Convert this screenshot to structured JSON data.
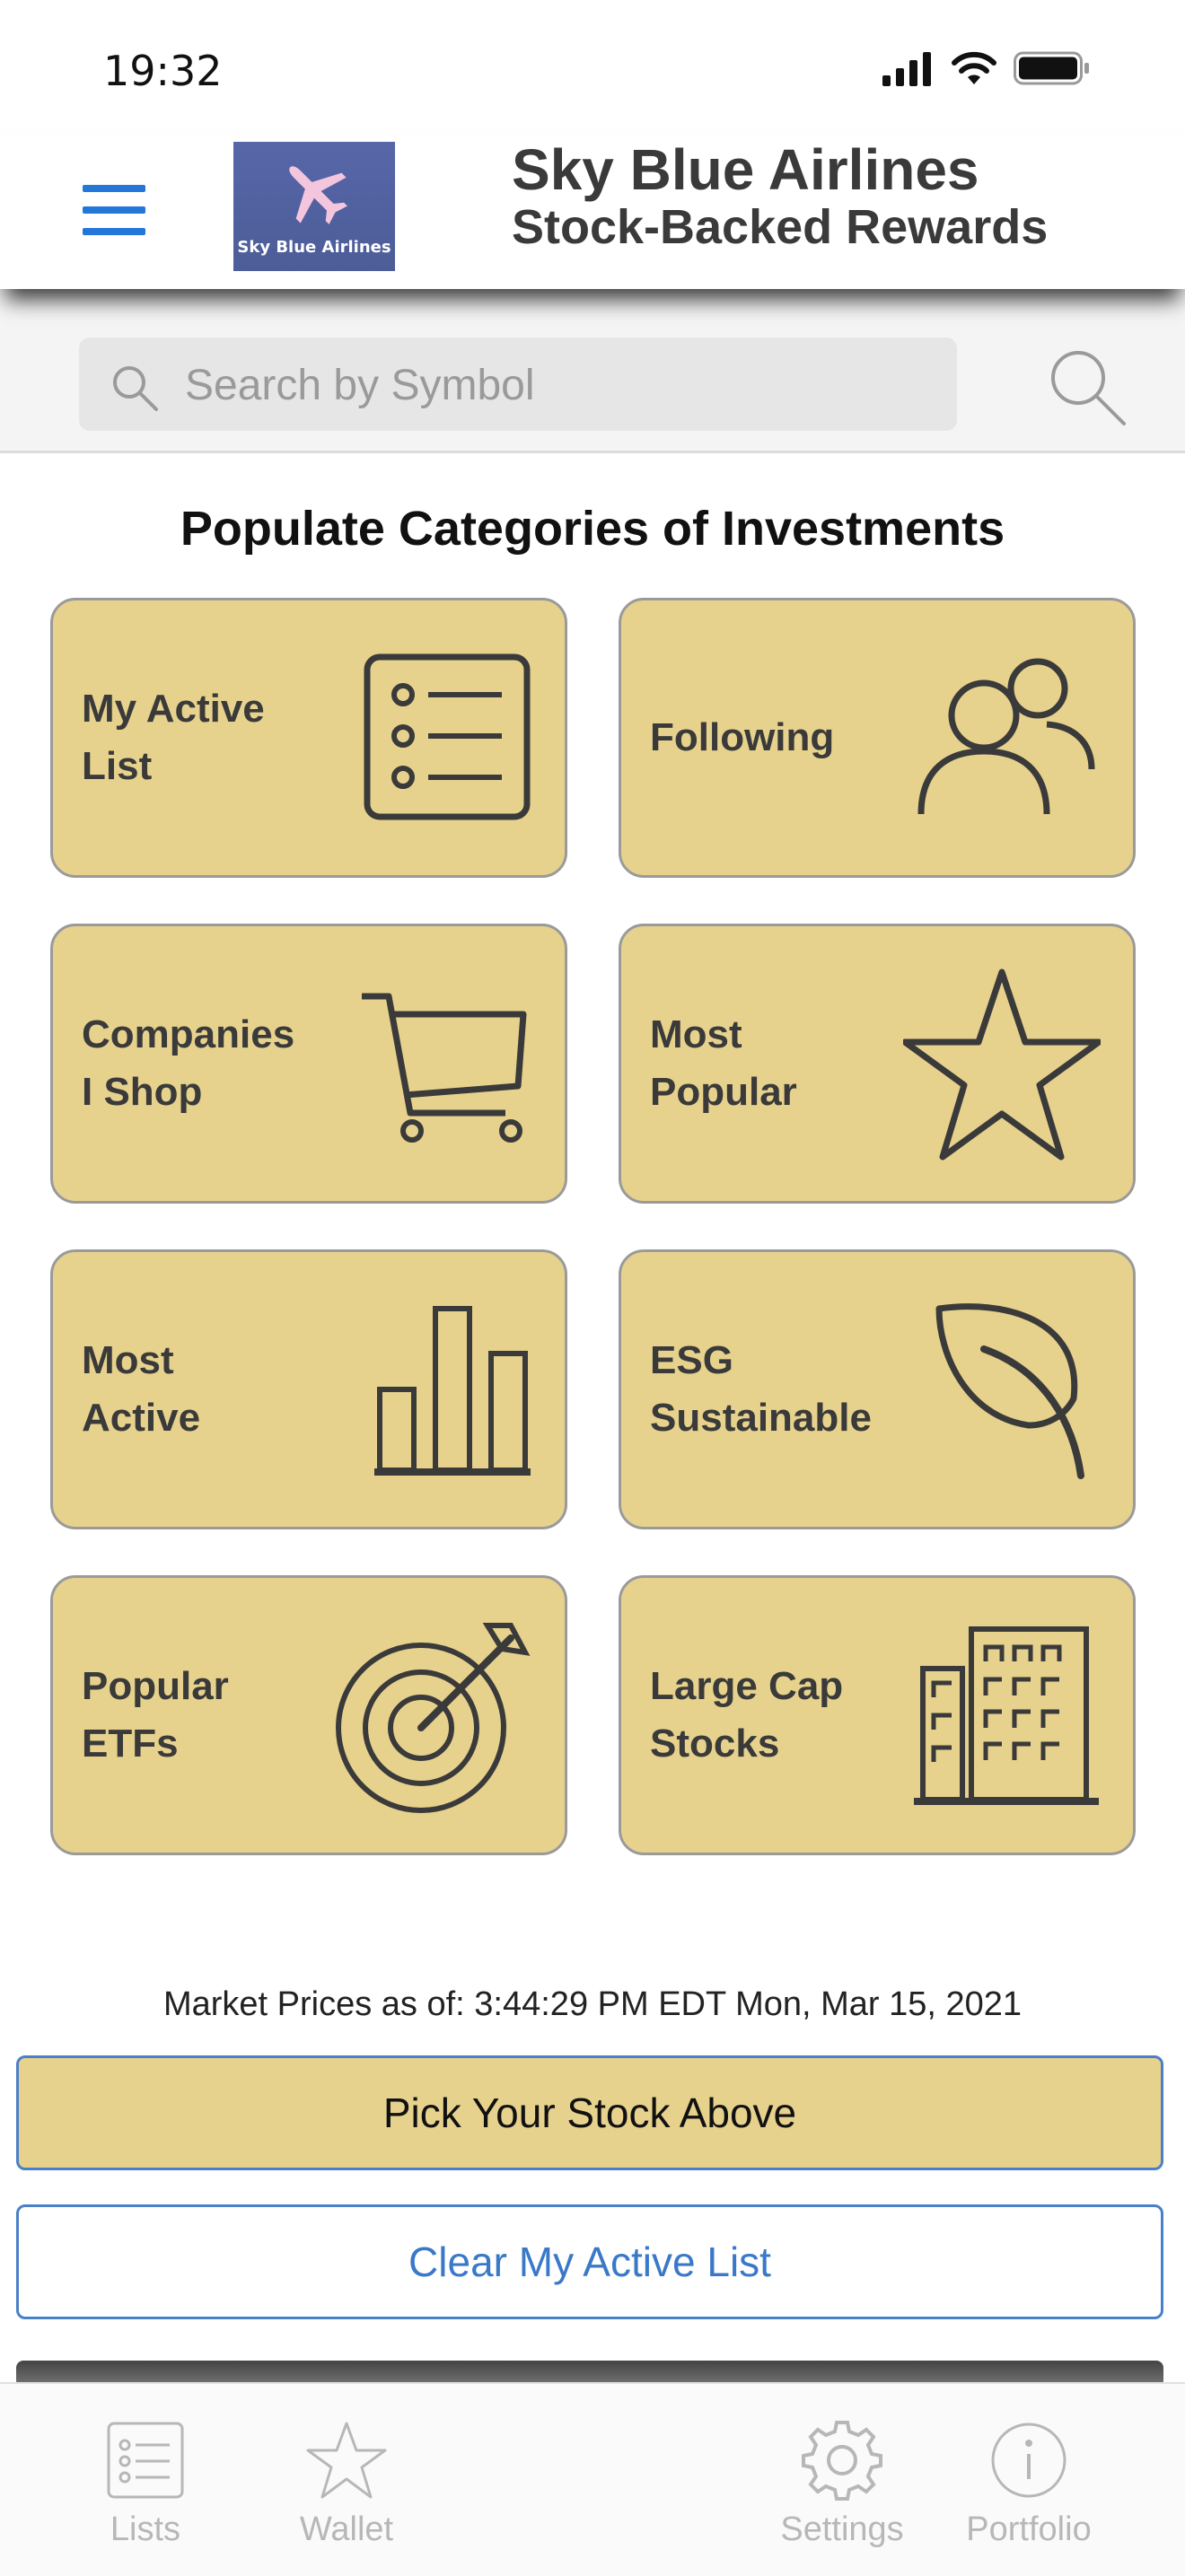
{
  "status_bar": {
    "time": "19:32"
  },
  "header": {
    "logo_text": "Sky Blue Airlines",
    "title": "Sky Blue Airlines",
    "subtitle": "Stock-Backed Rewards"
  },
  "search": {
    "placeholder": "Search by Symbol"
  },
  "section_title": "Populate Categories of Investments",
  "categories": [
    {
      "label": "My Active\nList",
      "icon": "list-icon"
    },
    {
      "label": "Following",
      "icon": "people-icon"
    },
    {
      "label": "Companies\nI Shop",
      "icon": "cart-icon"
    },
    {
      "label": "Most\nPopular",
      "icon": "star-icon"
    },
    {
      "label": "Most\nActive",
      "icon": "bar-chart-icon"
    },
    {
      "label": "ESG\nSustainable",
      "icon": "leaf-icon"
    },
    {
      "label": "Popular\nETFs",
      "icon": "target-icon"
    },
    {
      "label": "Large Cap\nStocks",
      "icon": "building-icon"
    }
  ],
  "market_prices": "Market Prices as of: 3:44:29 PM EDT Mon, Mar 15, 2021",
  "buttons": {
    "pick": "Pick Your Stock Above",
    "clear": "Clear My Active List"
  },
  "tabs": [
    {
      "label": "Lists",
      "icon": "list-icon"
    },
    {
      "label": "Wallet",
      "icon": "star-icon"
    },
    {
      "label": "Settings",
      "icon": "gear-icon"
    },
    {
      "label": "Portfolio",
      "icon": "info-icon"
    }
  ],
  "colors": {
    "tile": "#e7d28d",
    "accent_blue": "#2277d8",
    "button_border": "#4a80c8"
  }
}
